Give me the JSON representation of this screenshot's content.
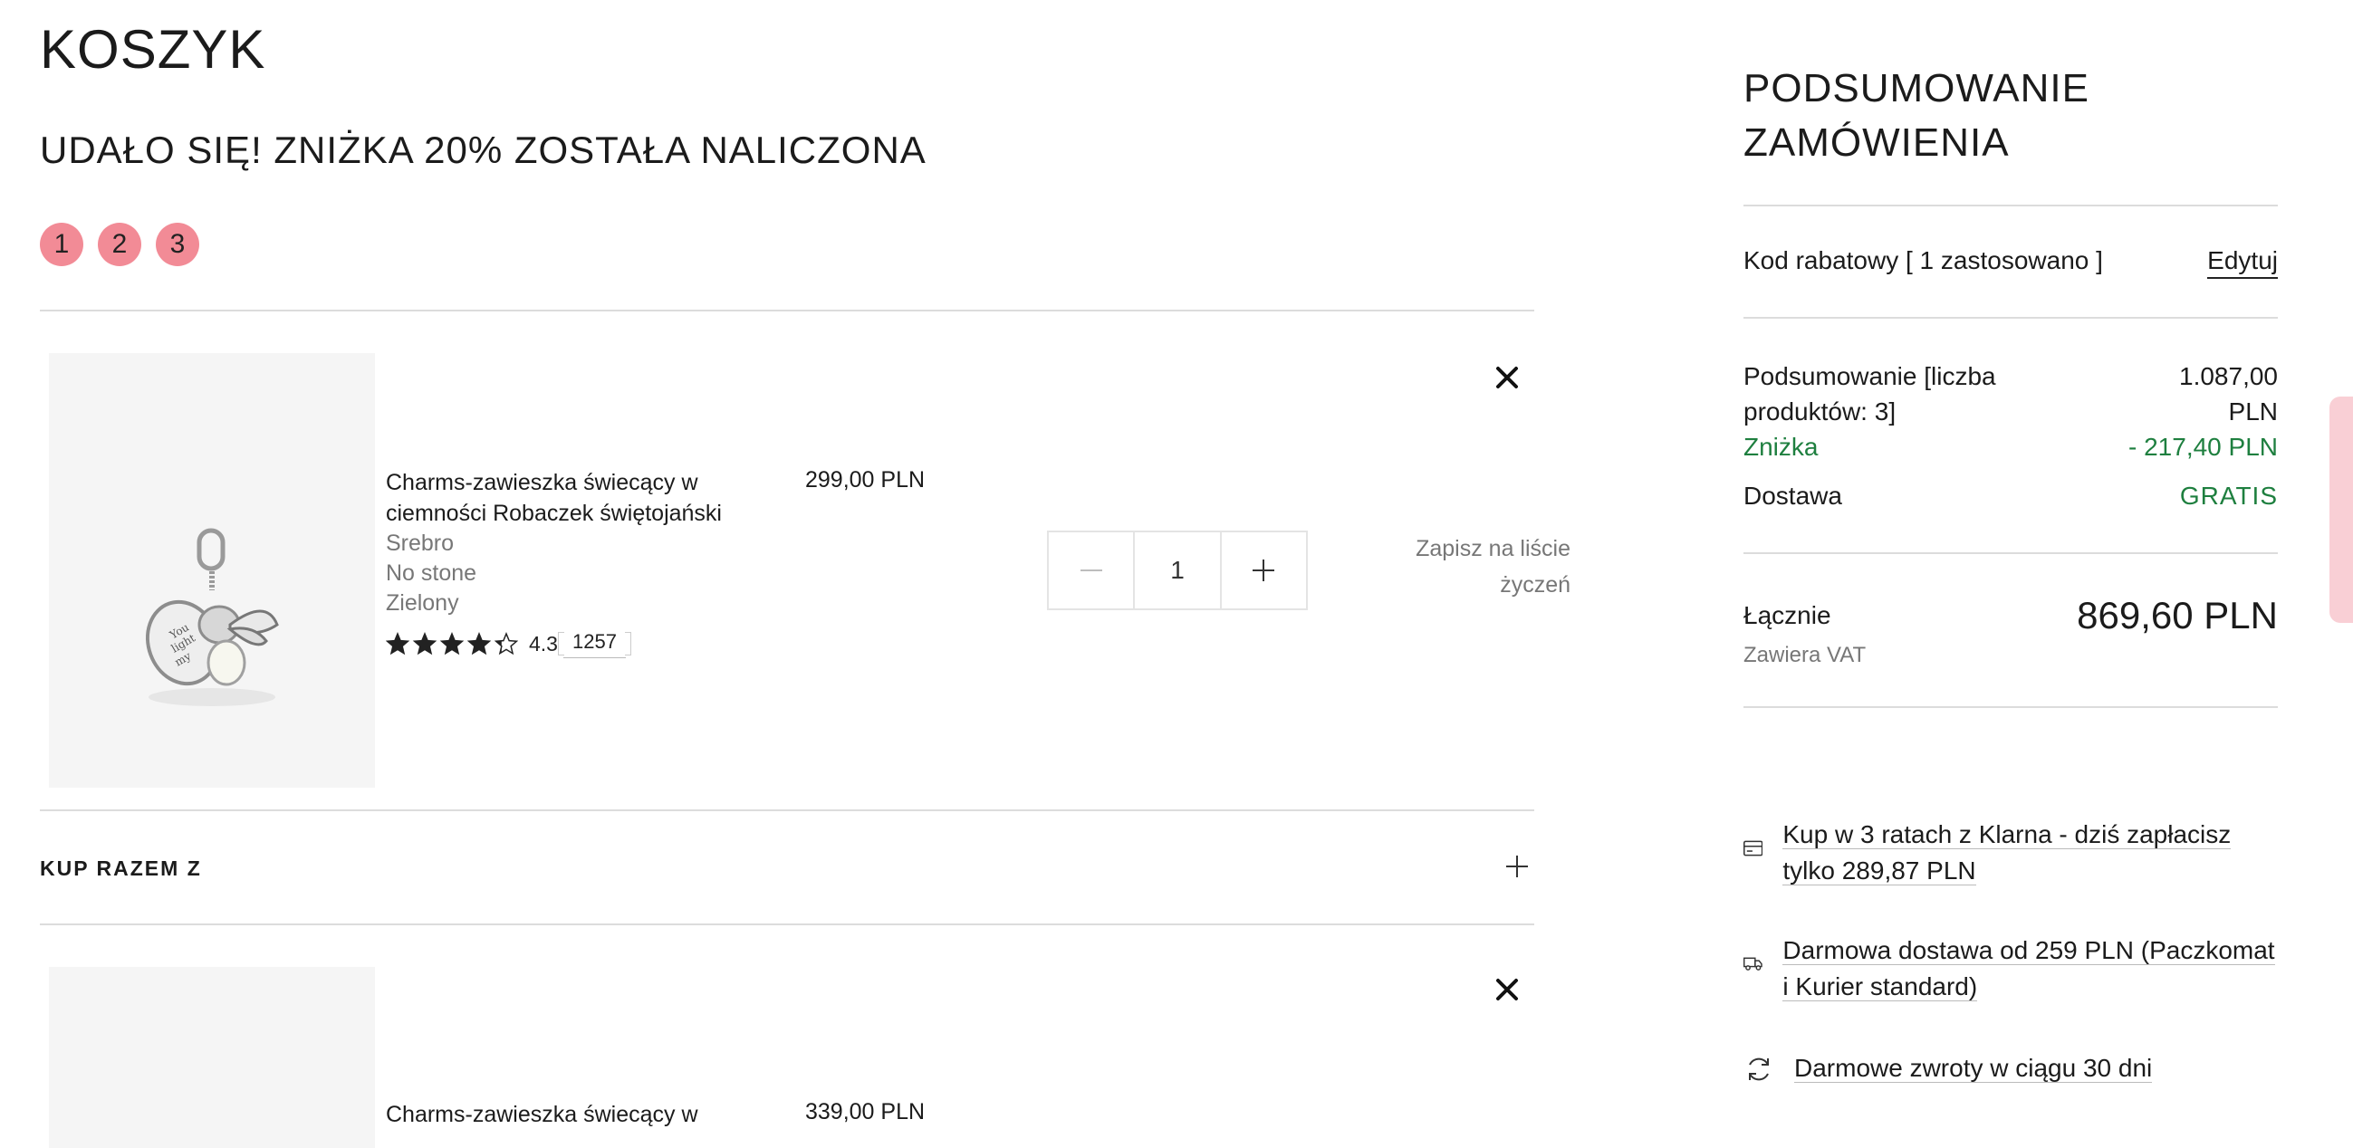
{
  "page": {
    "title": "KOSZYK",
    "subtitle": "UDAŁO SIĘ! ZNIŻKA 20% ZOSTAŁA NALICZONA",
    "steps": [
      "1",
      "2",
      "3"
    ]
  },
  "items": [
    {
      "name": "Charms-zawieszka świecący w ciemności Robaczek świętojański",
      "material": "Srebro",
      "stone": "No stone",
      "color": "Zielony",
      "price": "299,00 PLN",
      "rating": "4.3",
      "rating_value": 4.3,
      "reviews": "1257",
      "qty": "1",
      "save_label": "Zapisz na liście życzeń"
    },
    {
      "name": "Charms-zawieszka świecący w",
      "price": "339,00 PLN"
    }
  ],
  "bundle": {
    "label": "KUP RAZEM Z"
  },
  "summary": {
    "title": "PODSUMOWANIE ZAMÓWIENIA",
    "discount_code_label": "Kod rabatowy [ 1 zastosowano ]",
    "edit_label": "Edytuj",
    "subtotal_label": "Podsumowanie [liczba produktów: 3]",
    "subtotal_value": "1.087,00 PLN",
    "discount_label": "Zniżka",
    "discount_value": "- 217,40 PLN",
    "shipping_label": "Dostawa",
    "shipping_value": "GRATIS",
    "total_label": "Łącznie",
    "total_value": "869,60 PLN",
    "vat_note": "Zawiera VAT"
  },
  "info": [
    {
      "icon": "card-icon",
      "text": "Kup w 3 ratach z Klarna - dziś zapłacisz tylko 289,87 PLN"
    },
    {
      "icon": "truck-icon",
      "text": "Darmowa dostawa od 259 PLN (Paczkomat i Kurier standard)"
    },
    {
      "icon": "refresh-icon",
      "text": "Darmowe zwroty w ciągu 30 dni"
    }
  ],
  "colors": {
    "step_bg": "#f28b96",
    "discount_green": "#1e7f3f",
    "divider": "#dcdcdc"
  }
}
